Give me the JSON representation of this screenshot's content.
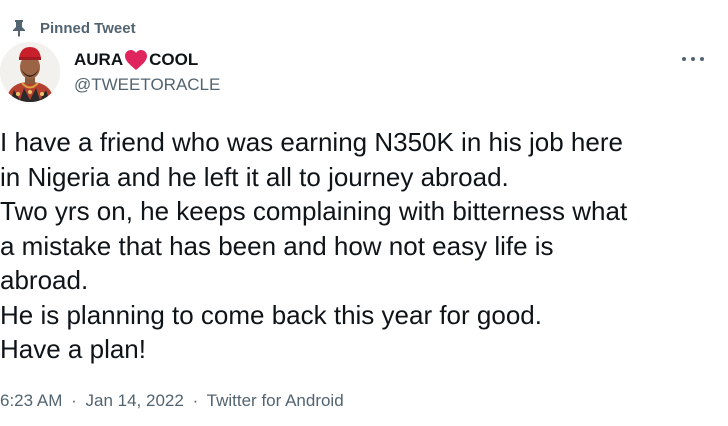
{
  "pinned": {
    "label": "Pinned Tweet",
    "icon": "pin-icon"
  },
  "author": {
    "name_part1": "AURA",
    "name_emoji": "heart-icon",
    "name_part2": "COOL",
    "handle": "@TWEETORACLE"
  },
  "menu": {
    "icon": "more-options-icon"
  },
  "tweet": {
    "lines": [
      "I have a friend who was earning N350K in his job here",
      "in Nigeria and he left it all to journey abroad.",
      "Two yrs on, he keeps complaining with bitterness what",
      "a mistake that has been and how not easy life is",
      "abroad.",
      "He is planning to come back this year for good.",
      "Have a plan!"
    ]
  },
  "meta": {
    "time": "6:23 AM",
    "separator": "·",
    "date": "Jan 14, 2022",
    "source": "Twitter for Android"
  },
  "colors": {
    "text_primary": "#0f1419",
    "text_secondary": "#536471",
    "heart": "#e0245e"
  }
}
